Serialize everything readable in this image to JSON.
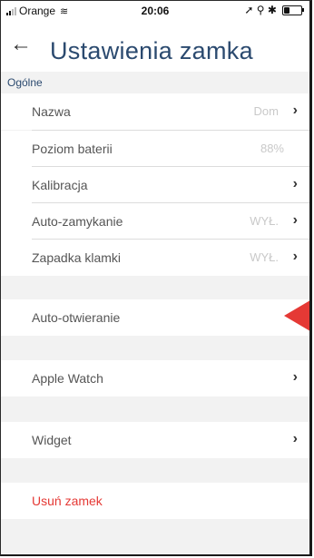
{
  "status_bar": {
    "carrier": "Orange",
    "time": "20:06",
    "right_icons": "➚ ⚲ ✱"
  },
  "header": {
    "back_icon": "←",
    "title": "Ustawienia zamka"
  },
  "section": {
    "label": "Ogólne"
  },
  "general": {
    "name": {
      "label": "Nazwa",
      "value": "Dom"
    },
    "battery": {
      "label": "Poziom baterii",
      "value": "88%"
    },
    "calibration": {
      "label": "Kalibracja"
    },
    "autolock": {
      "label": "Auto-zamykanie",
      "value": "WYŁ."
    },
    "latch": {
      "label": "Zapadka klamki",
      "value": "WYŁ."
    }
  },
  "auto_open": {
    "label": "Auto-otwieranie"
  },
  "apple_watch": {
    "label": "Apple Watch"
  },
  "widget": {
    "label": "Widget"
  },
  "delete": {
    "label": "Usuń zamek"
  },
  "chevron": "›",
  "colors": {
    "title": "#2b4a6f",
    "delete": "#e53935",
    "pointer": "#e53935"
  }
}
